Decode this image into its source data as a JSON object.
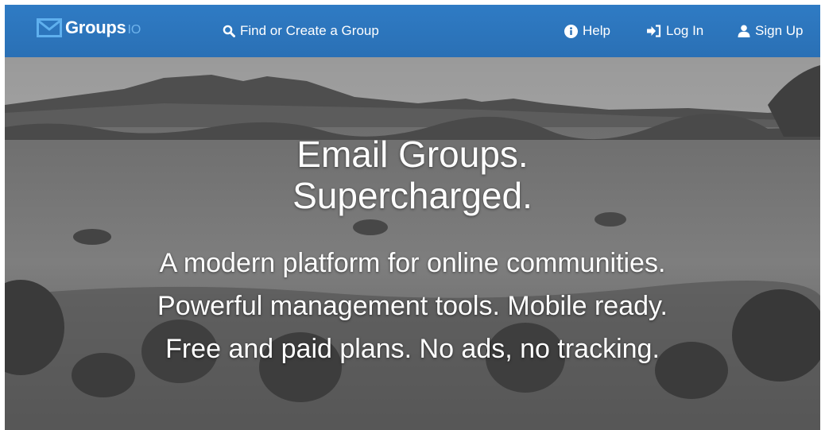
{
  "navbar": {
    "brand": {
      "name": "Groups",
      "suffix": "IO"
    },
    "find_label": "Find or Create a Group",
    "help_label": "Help",
    "login_label": "Log In",
    "signup_label": "Sign Up"
  },
  "hero": {
    "headline_line1": "Email Groups.",
    "headline_line2": "Supercharged.",
    "tagline": "A modern platform for online communities. Powerful management tools. Mobile ready. Free and paid plans. No ads, no tracking."
  },
  "colors": {
    "navbar_bg": "#2a70b5",
    "brand_suffix": "#6fb3ec",
    "text": "#ffffff"
  },
  "icons": {
    "logo": "envelope-icon",
    "find": "search-icon",
    "help": "info-circle-icon",
    "login": "sign-in-icon",
    "signup": "user-icon"
  }
}
